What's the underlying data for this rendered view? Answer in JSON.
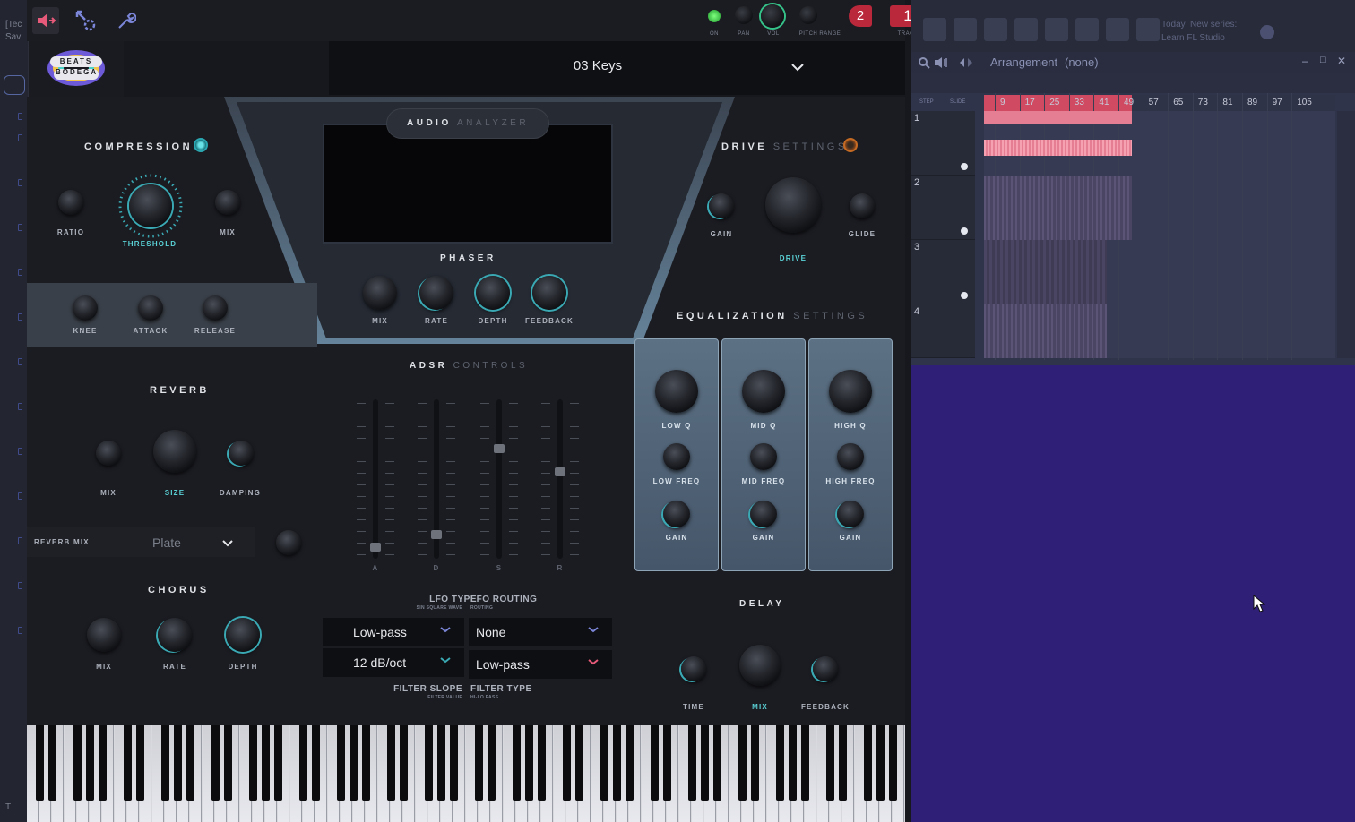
{
  "left_panel": {
    "lines": [
      "[Tec",
      "Sav",
      "T"
    ]
  },
  "toolbar": {
    "mini_labels": {
      "on": "ON",
      "pan": "PAN",
      "vol": "VOL",
      "pitch_range": "PITCH RANGE",
      "track": "TRACK"
    },
    "pitch_value": "2",
    "track_value": "1",
    "icons": [
      "speaker-arrow-icon",
      "plugin-settings-icon",
      "wrench-icon"
    ]
  },
  "header": {
    "logo_text": "BEATS BODEGA",
    "preset_name": "03 Keys"
  },
  "compression": {
    "title": "COMPRESSION",
    "ratio": "RATIO",
    "threshold": "THRESHOLD",
    "mix": "MIX",
    "knee": "KNEE",
    "attack": "ATTACK",
    "release": "RELEASE"
  },
  "analyzer": {
    "title_a": "AUDIO",
    "title_b": "ANALYZER"
  },
  "phaser": {
    "title": "PHASER",
    "mix": "MIX",
    "rate": "RATE",
    "depth": "DEPTH",
    "feedback": "FEEDBACK"
  },
  "drive": {
    "title_a": "DRIVE",
    "title_b": "SETTINGS",
    "gain": "GAIN",
    "drive": "DRIVE",
    "glide": "GLIDE"
  },
  "eq": {
    "title_a": "EQUALIZATION",
    "title_b": "SETTINGS",
    "columns": [
      {
        "q": "LOW Q",
        "freq": "LOW FREQ",
        "gain": "GAIN"
      },
      {
        "q": "MID Q",
        "freq": "MID FREQ",
        "gain": "GAIN"
      },
      {
        "q": "HIGH Q",
        "freq": "HIGH FREQ",
        "gain": "GAIN"
      }
    ]
  },
  "reverb": {
    "title": "REVERB",
    "mix": "MIX",
    "size": "SIZE",
    "damping": "DAMPING",
    "reverb_mix_label": "REVERB MIX",
    "type_value": "Plate"
  },
  "adsr": {
    "title_a": "ADSR",
    "title_b": "CONTROLS",
    "labels": [
      "A",
      "D",
      "S",
      "R"
    ],
    "levels": [
      0.05,
      0.13,
      0.7,
      0.55
    ]
  },
  "lfo": {
    "lfo_type": "LFO TYPE",
    "lfo_type_sub": "SIN SQUARE WAVE",
    "lfo_routing": "LFO ROUTING",
    "lfo_routing_sub": "ROUTING",
    "lfo_type_value": "Low-pass",
    "lfo_routing_value": "None",
    "filter_slope_value": "12 dB/oct",
    "filter_type_value": "Low-pass",
    "filter_slope": "FILTER SLOPE",
    "filter_slope_sub": "FILTER VALUE",
    "filter_type": "FILTER TYPE",
    "filter_type_sub": "HI-LO PASS"
  },
  "chorus": {
    "title": "CHORUS",
    "mix": "MIX",
    "rate": "RATE",
    "depth": "DEPTH"
  },
  "delay": {
    "title": "DELAY",
    "time": "TIME",
    "mix": "MIX",
    "feedback": "FEEDBACK"
  },
  "daw": {
    "news": {
      "today": "Today",
      "new_series": "New series:",
      "learn": "Learn FL Studio"
    },
    "window_title": "Arrangement",
    "window_sub": "(none)",
    "step": "STEP",
    "slide": "SLIDE",
    "timeline": [
      "9",
      "17",
      "25",
      "33",
      "41",
      "49",
      "57",
      "65",
      "73",
      "81",
      "89",
      "97",
      "105"
    ],
    "tracks": [
      "1",
      "2",
      "3",
      "4"
    ]
  },
  "colors": {
    "accent": "#3aa9b3",
    "record": "#b9283b",
    "pattern": "#f08f9f",
    "daw_bg": "#2f1f77"
  }
}
